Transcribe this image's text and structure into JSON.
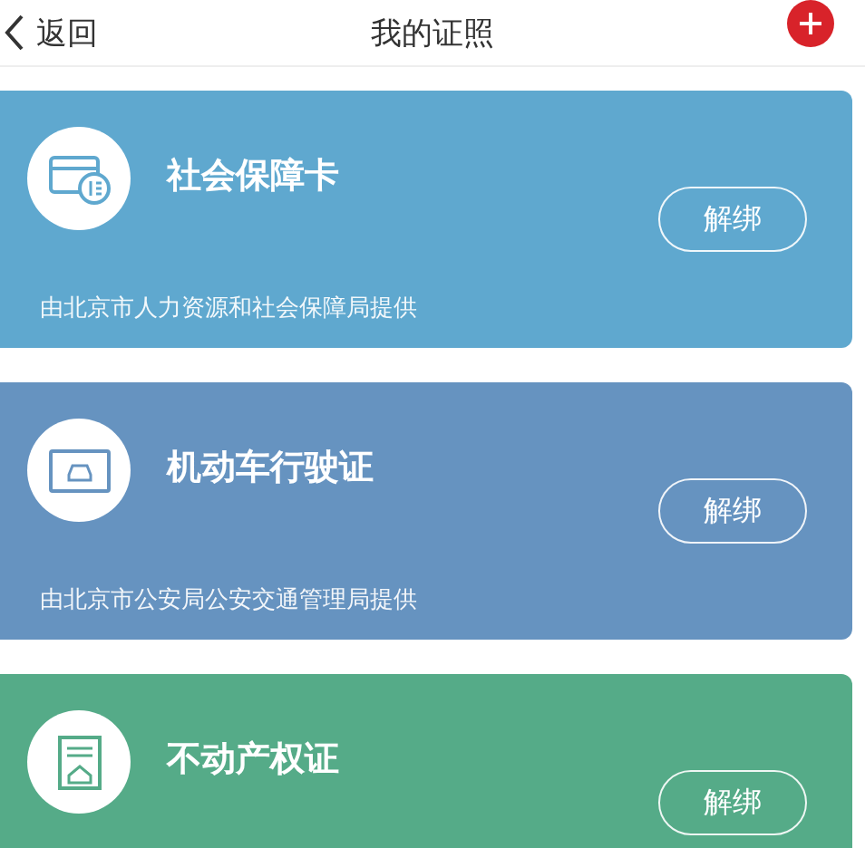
{
  "header": {
    "back": "返回",
    "title": "我的证照"
  },
  "cards": [
    {
      "kind": "card",
      "color": "#5fa8cf",
      "title": "社会保障卡",
      "button": "解绑",
      "provider": "由北京市人力资源和社会保障局提供"
    },
    {
      "kind": "car",
      "color": "#6693c0",
      "title": "机动车行驶证",
      "button": "解绑",
      "provider": "由北京市公安局公安交通管理局提供"
    },
    {
      "kind": "property",
      "color": "#55ab88",
      "title": "不动产权证",
      "button": "解绑"
    }
  ]
}
